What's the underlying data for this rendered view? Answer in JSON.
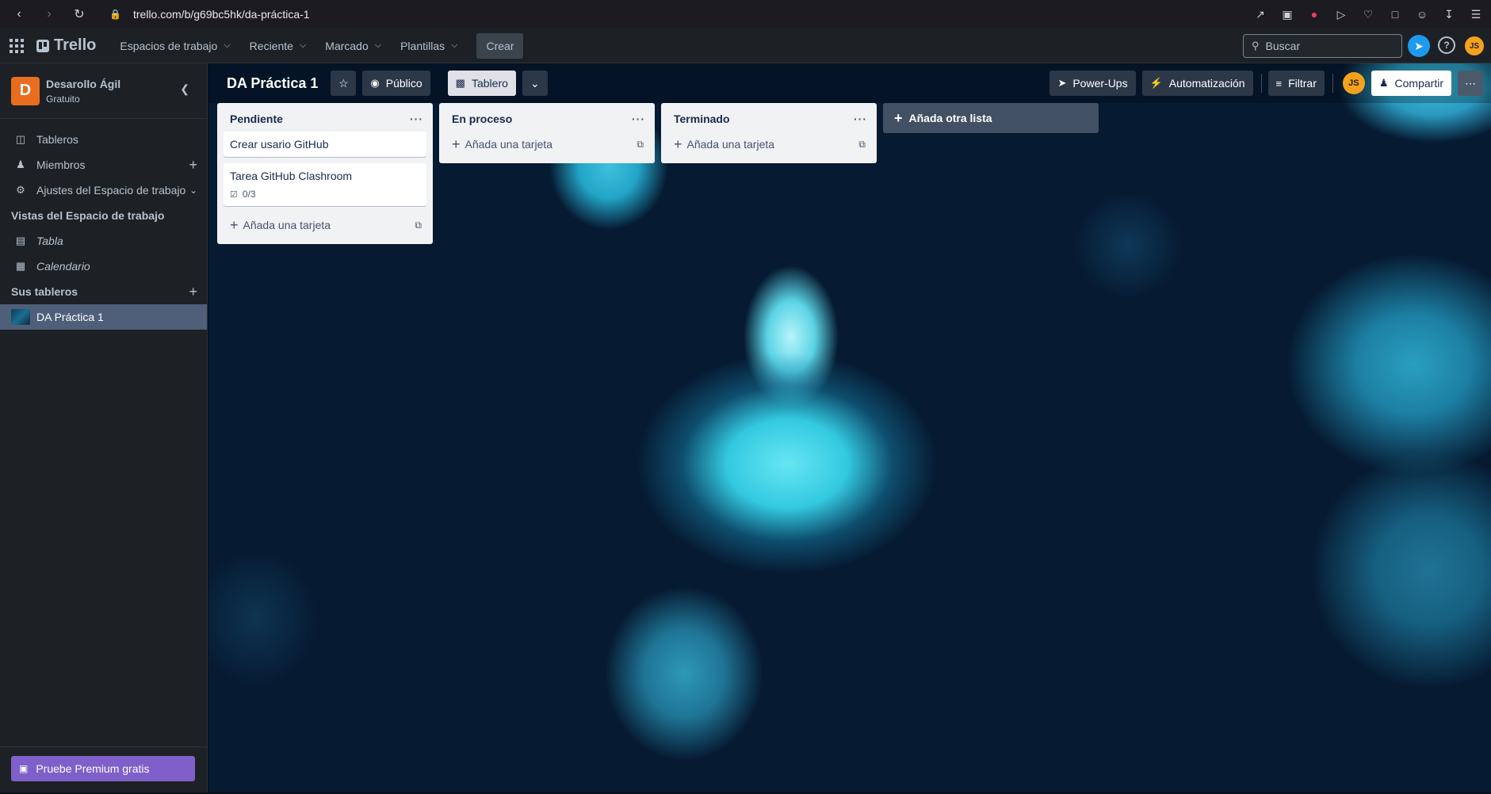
{
  "browser": {
    "url": "trello.com/b/g69bc5hk/da-práctica-1"
  },
  "header": {
    "logo": "Trello",
    "menu": [
      {
        "label": "Espacios de trabajo"
      },
      {
        "label": "Reciente"
      },
      {
        "label": "Marcado"
      },
      {
        "label": "Plantillas"
      }
    ],
    "create_label": "Crear",
    "search_placeholder": "Buscar",
    "avatar_initials": "JS"
  },
  "sidebar": {
    "workspace_initial": "D",
    "workspace_name": "Desarollo Ágil",
    "workspace_plan": "Gratuito",
    "items": [
      {
        "label": "Tableros"
      },
      {
        "label": "Miembros"
      },
      {
        "label": "Ajustes del Espacio de trabajo"
      }
    ],
    "views_heading": "Vistas del Espacio de trabajo",
    "views": [
      {
        "label": "Tabla"
      },
      {
        "label": "Calendario"
      }
    ],
    "boards_heading": "Sus tableros",
    "boards": [
      {
        "label": "DA Práctica 1"
      }
    ],
    "premium_label": "Pruebe Premium gratis"
  },
  "board": {
    "title": "DA Práctica 1",
    "visibility": "Público",
    "view": "Tablero",
    "powerups": "Power-Ups",
    "automation": "Automatización",
    "filter": "Filtrar",
    "share": "Compartir",
    "avatar_initials": "JS",
    "add_list": "Añada otra lista",
    "add_card": "Añada una tarjeta",
    "lists": [
      {
        "title": "Pendiente",
        "cards": [
          {
            "title": "Crear usario GitHub"
          },
          {
            "title": "Tarea GitHub Clashroom",
            "checklist": "0/3"
          }
        ]
      },
      {
        "title": "En proceso",
        "cards": []
      },
      {
        "title": "Terminado",
        "cards": []
      }
    ]
  },
  "colors": {
    "accent": "#1d9aee",
    "premium": "#7f5fc9",
    "workspace_avatar": "#e86d1f",
    "user_avatar": "#f4a11d"
  }
}
